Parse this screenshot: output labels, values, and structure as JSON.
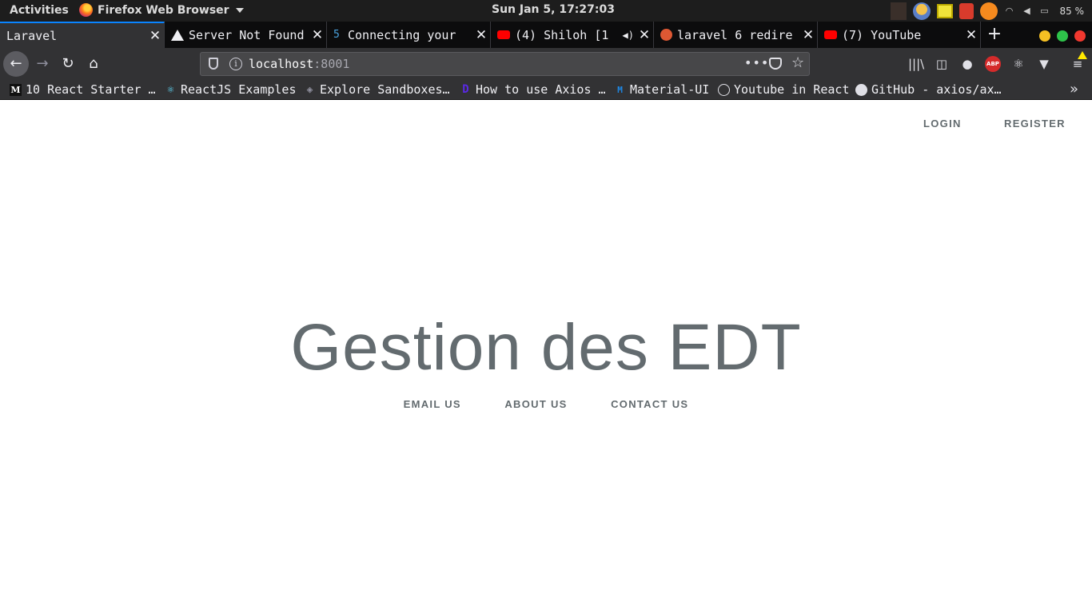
{
  "topbar": {
    "activities": "Activities",
    "app_name": "Firefox Web Browser",
    "clock": "Sun Jan  5, 17:27:03",
    "battery": "85 %"
  },
  "tabs": [
    {
      "title": "Laravel",
      "icon": "none",
      "active": true
    },
    {
      "title": "Server Not Found",
      "icon": "warning-icon",
      "active": false
    },
    {
      "title": "Connecting your",
      "icon": "five-icon",
      "active": false
    },
    {
      "title": "(4) Shiloh [1",
      "icon": "youtube-icon",
      "active": false,
      "playing_audio": true
    },
    {
      "title": "laravel 6 redire",
      "icon": "duckduckgo-icon",
      "active": false
    },
    {
      "title": "(7) YouTube",
      "icon": "youtube-icon",
      "active": false
    }
  ],
  "urlbar": {
    "host": "localhost",
    "port": ":8001"
  },
  "bookmarks": [
    {
      "label": "10 React Starter …",
      "icon": "medium-icon"
    },
    {
      "label": "ReactJS Examples",
      "icon": "react-icon"
    },
    {
      "label": "Explore Sandboxes…",
      "icon": "codesandbox-icon"
    },
    {
      "label": "How to use Axios …",
      "icon": "axios-icon"
    },
    {
      "label": "Material-UI",
      "icon": "material-ui-icon"
    },
    {
      "label": "Youtube in React",
      "icon": "globe-icon"
    },
    {
      "label": "GitHub - axios/ax…",
      "icon": "github-icon"
    }
  ],
  "page": {
    "auth_links": {
      "login": "Login",
      "register": "Register"
    },
    "title": "Gestion des EDT",
    "links": [
      "Email us",
      "About us",
      "Contact us"
    ]
  },
  "colors": {
    "text": "#636b6f",
    "tab_accent": "#0a84ff",
    "chrome_bg": "#323234"
  }
}
